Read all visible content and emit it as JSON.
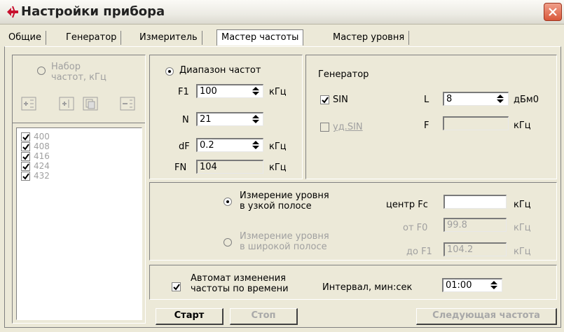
{
  "window": {
    "title": "Настройки прибора",
    "accent": "#d9573a"
  },
  "tabs": [
    "Общие",
    "Генератор",
    "Измеритель",
    "Мастер частоты",
    "Мастер уровня"
  ],
  "active_tab": "Мастер частоты",
  "left_panel": {
    "radio_label": "Набор частот, кГц",
    "toolbar_icons": [
      "add-item-icon",
      "insert-item-icon",
      "copy-item-icon",
      "remove-item-icon"
    ],
    "freq_list": [
      "400",
      "408",
      "416",
      "424",
      "432"
    ]
  },
  "range": {
    "radio_label": "Диапазон частот",
    "f1_label": "F1",
    "f1_value": "100",
    "f1_unit": "кГц",
    "n_label": "N",
    "n_value": "21",
    "df_label": "dF",
    "df_value": "0.2",
    "df_unit": "кГц",
    "fn_label": "FN",
    "fn_value": "104",
    "fn_unit": "кГц"
  },
  "generator": {
    "title": "Генератор",
    "sin_label": "SIN",
    "ud_sin_label": "уд.SIN",
    "l_label": "L",
    "l_value": "8",
    "l_unit": "дБм0",
    "f_label": "F",
    "f_value": "",
    "f_unit": "кГц"
  },
  "measure": {
    "narrow_label_1": "Измерение уровня",
    "narrow_label_2": "в узкой полосе",
    "wide_label_1": "Измерение уровня",
    "wide_label_2": "в широкой полосе",
    "fc_label": "центр Fc",
    "fc_value": "",
    "fc_unit": "кГц",
    "f0_label": "от F0",
    "f0_value": "99.8",
    "f0_unit": "кГц",
    "f1_label": "до F1",
    "f1_value": "104.2",
    "f1_unit": "кГц"
  },
  "auto": {
    "label_1": "Автомат изменения",
    "label_2": "частоты по времени",
    "interval_label": "Интервал, мин:сек",
    "interval_value": "01:00"
  },
  "buttons": {
    "start": "Старт",
    "stop": "Стоп",
    "next": "Следующая частота"
  }
}
